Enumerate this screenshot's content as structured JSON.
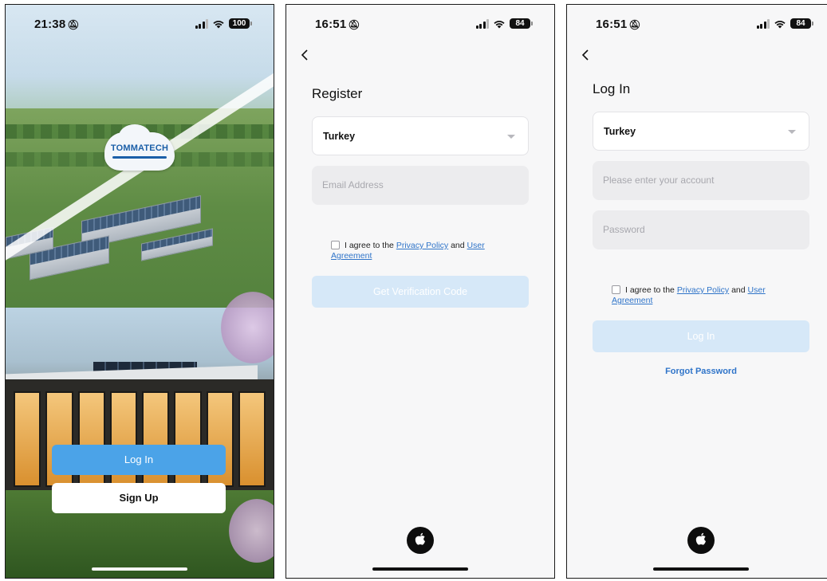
{
  "screen1": {
    "status": {
      "time": "21:38",
      "battery": "100"
    },
    "logo_text": "TOMMATECH",
    "login_label": "Log In",
    "signup_label": "Sign Up"
  },
  "screen2": {
    "status": {
      "time": "16:51",
      "battery": "84"
    },
    "title": "Register",
    "country": "Turkey",
    "email_placeholder": "Email Address",
    "agree": {
      "prefix": "I agree to the",
      "privacy": "Privacy Policy",
      "and": "and",
      "user_agreement": "User Agreement"
    },
    "submit_label": "Get Verification Code"
  },
  "screen3": {
    "status": {
      "time": "16:51",
      "battery": "84"
    },
    "title": "Log In",
    "country": "Turkey",
    "account_placeholder": "Please enter your account",
    "password_placeholder": "Password",
    "agree": {
      "prefix": "I agree to the",
      "privacy": "Privacy Policy",
      "and": "and",
      "user_agreement": "User Agreement"
    },
    "submit_label": "Log In",
    "forgot_label": "Forgot Password"
  },
  "icons": [
    "back-chevron-icon",
    "signal-icon",
    "wifi-icon",
    "battery-icon",
    "bell-slash-icon",
    "apple-icon",
    "dropdown-caret-icon"
  ],
  "colors": {
    "primary": "#4ba3e8",
    "disabled_button": "#d6e8f8",
    "link": "#2f74c9",
    "field_bg": "#ececee"
  }
}
